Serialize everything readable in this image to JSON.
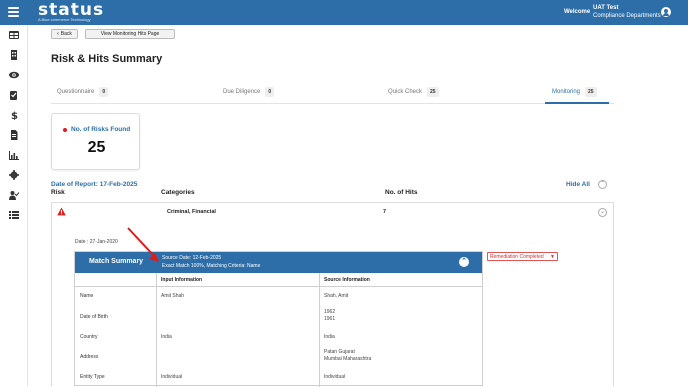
{
  "header": {
    "logo": "status",
    "logo_tagline": "A Blue commerce Technology",
    "welcome": "Welcome",
    "user_name": "UAT Test",
    "user_department": "Compliance Departments"
  },
  "sidebar": {
    "items": [
      {
        "icon": "table-icon"
      },
      {
        "icon": "building-icon"
      },
      {
        "icon": "eye-icon"
      },
      {
        "icon": "checklist-icon"
      },
      {
        "icon": "dollar-icon"
      },
      {
        "icon": "document-icon"
      },
      {
        "icon": "chart-icon"
      },
      {
        "icon": "gear-icon"
      },
      {
        "icon": "user-check-icon"
      },
      {
        "icon": "list-icon"
      }
    ]
  },
  "toolbar": {
    "back_label": "Back",
    "view_monitoring_label": "View Monitoring Hits Page"
  },
  "page_title": "Risk & Hits Summary",
  "tabs": [
    {
      "label": "Questionnaire",
      "count": "0"
    },
    {
      "label": "Due Diligence",
      "count": "0"
    },
    {
      "label": "Quick Check",
      "count": "25"
    },
    {
      "label": "Monitoring",
      "count": "25",
      "active": true
    }
  ],
  "risk_card": {
    "label": "No. of Risks Found",
    "value": "25"
  },
  "report": {
    "date_label": "Date of Report: 17-Feb-2025",
    "hide_all": "Hide All"
  },
  "table_headers": {
    "risk": "Risk",
    "categories": "Categories",
    "hits": "No. of Hits"
  },
  "risk_row": {
    "categories": "Criminal, Financial",
    "hits": "7",
    "date": "Date : 27-Jan-2020",
    "status": "Remediation Completed"
  },
  "match_summary": {
    "title": "Match Summary",
    "source_date": "Source Date: 12-Feb-2025",
    "match_info": "Exact Match 100%, Matching Criteria: Name",
    "col_input": "Input Information",
    "col_source": "Source Information",
    "rows": [
      {
        "label": "Name",
        "input": "Amit Shah",
        "source": "Shah, Amit"
      },
      {
        "label": "Date of Birth",
        "input": "",
        "source_lines": [
          "1962",
          "1961"
        ]
      },
      {
        "label": "Country",
        "input": "India",
        "source": "India"
      },
      {
        "label": "Address",
        "input": "",
        "source_lines": [
          "Patan Gujarat",
          "Mumbai Maharashtra"
        ]
      },
      {
        "label": "Entity Type",
        "input": "Individual",
        "source": "Individual"
      }
    ]
  },
  "colors": {
    "brand_blue": "#2d6ea8",
    "danger_red": "#e01b1b"
  }
}
